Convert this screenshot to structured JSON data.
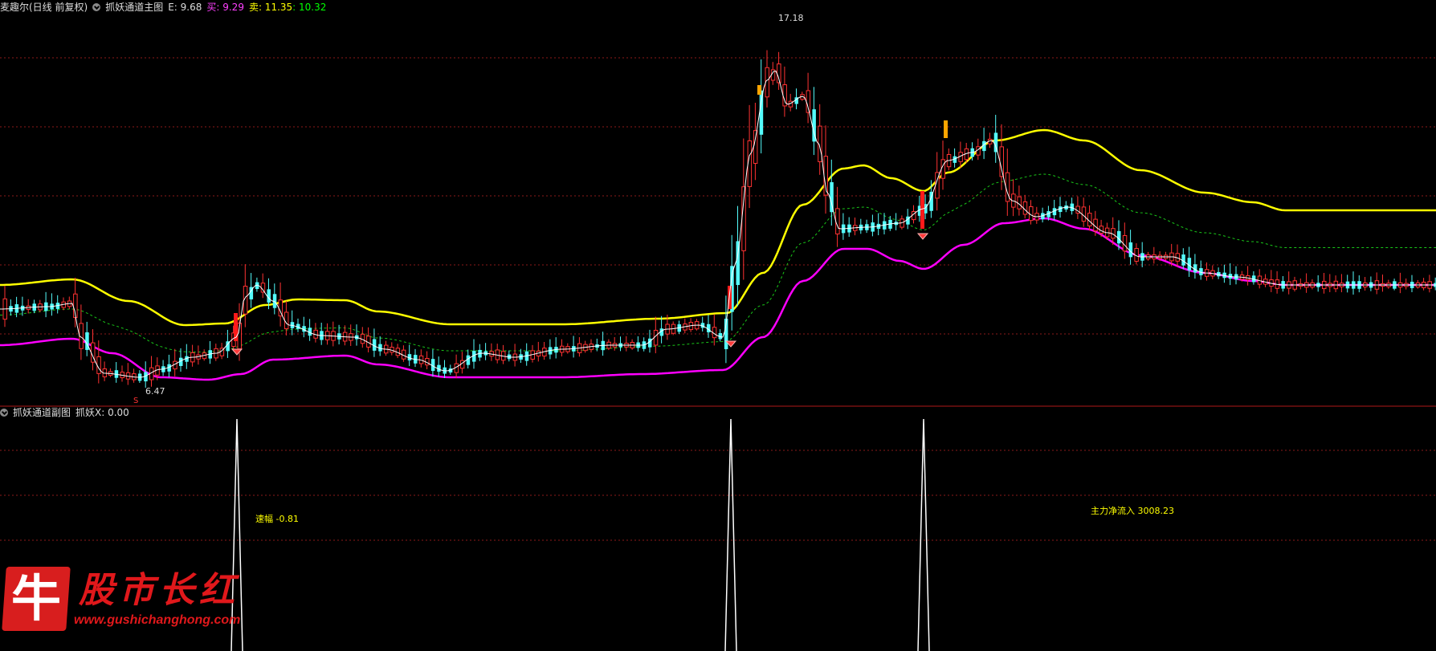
{
  "main_header": {
    "stock_name": "麦趣尔(日线 前复权)",
    "indicator_name": "抓妖通道主图",
    "e_label": "E: 9.68",
    "buy_label": "买: 9.29",
    "sell_label": "卖: 11.35",
    "sell_value2": ": 10.32"
  },
  "sub_header": {
    "indicator_name": "抓妖通道副图",
    "x_label": "抓妖X: 0.00"
  },
  "annotations": {
    "high_price": "17.18",
    "low_price": "6.47",
    "s_marker": "S",
    "speed": "速幅 -0.81",
    "main_inflow": "主力净流入 3008.23"
  },
  "logo": {
    "glyph": "牛",
    "title": "股市长红",
    "url": "www.gushichanghong.com"
  },
  "colors": {
    "background": "#000000",
    "grid": "#8b1a1a",
    "upper_band": "#ffff00",
    "middle_band": "#19c619",
    "lower_band": "#ff00ff",
    "price_line": "#ffffff",
    "up_candle": "#ff3232",
    "down_candle": "#54fcfc",
    "buy_text": "#ff40ff",
    "sell_text": "#ffff00",
    "sell_value2": "#00ff00"
  },
  "chart_data": {
    "type": "candlestick",
    "price_high": 17.18,
    "price_low": 6.47,
    "sub_signal_spikes": 3
  }
}
